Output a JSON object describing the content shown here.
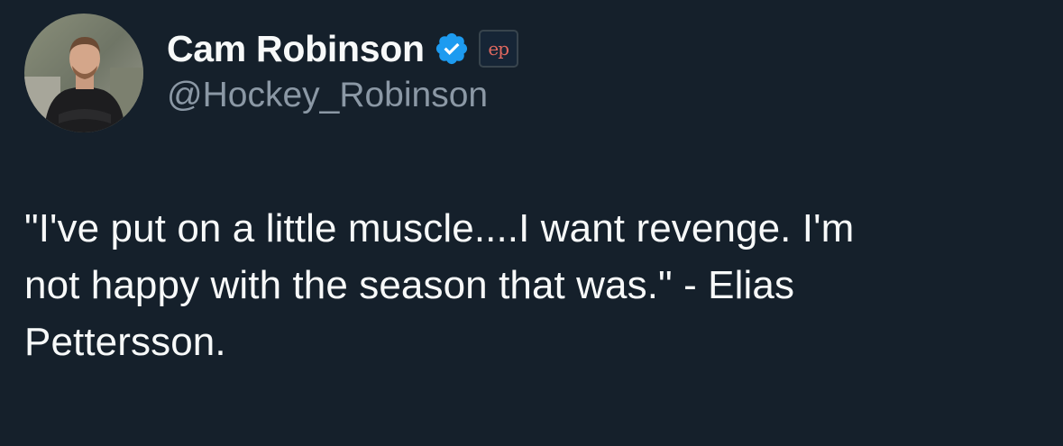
{
  "tweet": {
    "author": {
      "display_name": "Cam Robinson",
      "handle": "@Hockey_Robinson",
      "verified": true,
      "affiliate_badge_text": "ep"
    },
    "text": "\"I've put on a little muscle....I want revenge. I'm\nnot happy with the season that was.\" - Elias\nPettersson."
  },
  "colors": {
    "background": "#15202b",
    "primary_text": "#f7f9f9",
    "secondary_text": "#8b98a5",
    "verified_blue": "#1d9bf0",
    "affiliate_red": "#e0685f"
  }
}
